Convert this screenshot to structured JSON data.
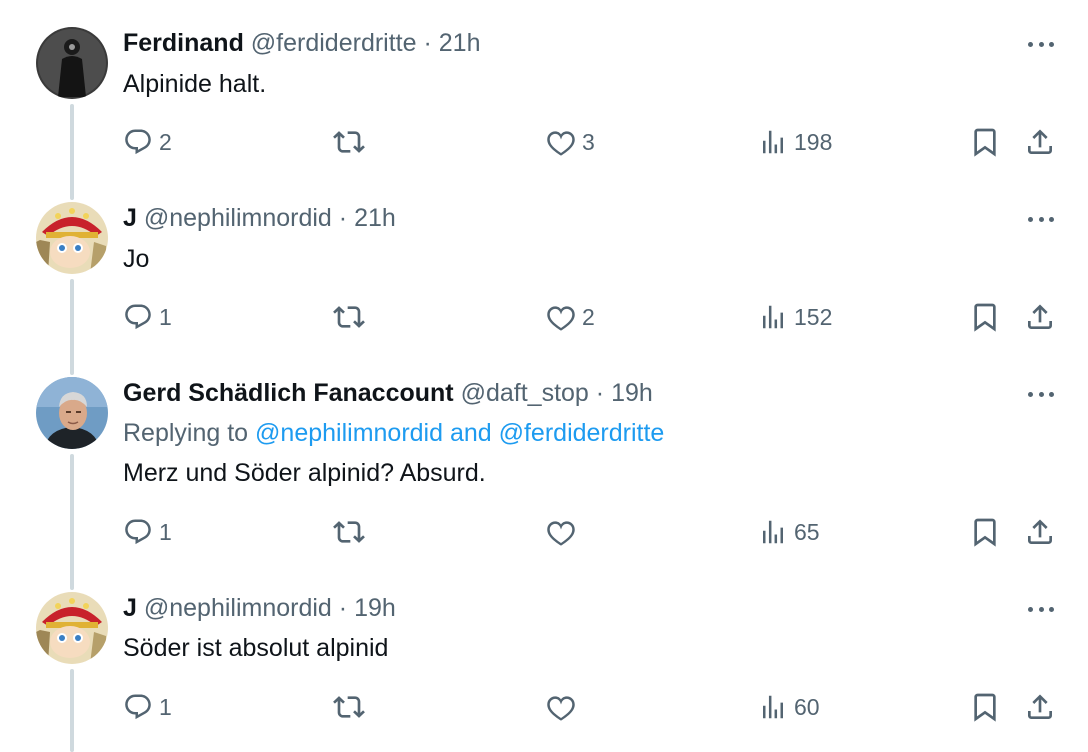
{
  "tweets": [
    {
      "name": "Ferdinand",
      "handle": "@ferdiderdritte",
      "separator": "·",
      "time": "21h",
      "text": "Alpinide halt.",
      "replies": "2",
      "retweets": "",
      "likes": "3",
      "views": "198",
      "avatar": "dark-figure-avatar"
    },
    {
      "name": "J",
      "handle": "@nephilimnordid",
      "separator": "·",
      "time": "21h",
      "text": "Jo",
      "replies": "1",
      "retweets": "",
      "likes": "2",
      "views": "152",
      "avatar": "cartoon-red-hat-avatar"
    },
    {
      "name": "Gerd Schädlich Fanaccount",
      "handle": "@daft_stop",
      "separator": "·",
      "time": "19h",
      "replying_prefix": "Replying to ",
      "replying_mentions": "@nephilimnordid and @ferdiderdritte",
      "text": "Merz und Söder alpinid? Absurd.",
      "replies": "1",
      "retweets": "",
      "likes": "",
      "views": "65",
      "avatar": "older-man-photo-avatar"
    },
    {
      "name": "J",
      "handle": "@nephilimnordid",
      "separator": "·",
      "time": "19h",
      "text": "Söder ist absolut alpinid",
      "replies": "1",
      "retweets": "",
      "likes": "",
      "views": "60",
      "avatar": "cartoon-red-hat-avatar"
    }
  ],
  "colors": {
    "text": "#0f1419",
    "secondary": "#536471",
    "link": "#1d9bf0",
    "thread_line": "#cfd9de"
  },
  "icons": [
    "reply-icon",
    "retweet-icon",
    "like-icon",
    "views-icon",
    "bookmark-icon",
    "share-icon",
    "more-icon"
  ]
}
